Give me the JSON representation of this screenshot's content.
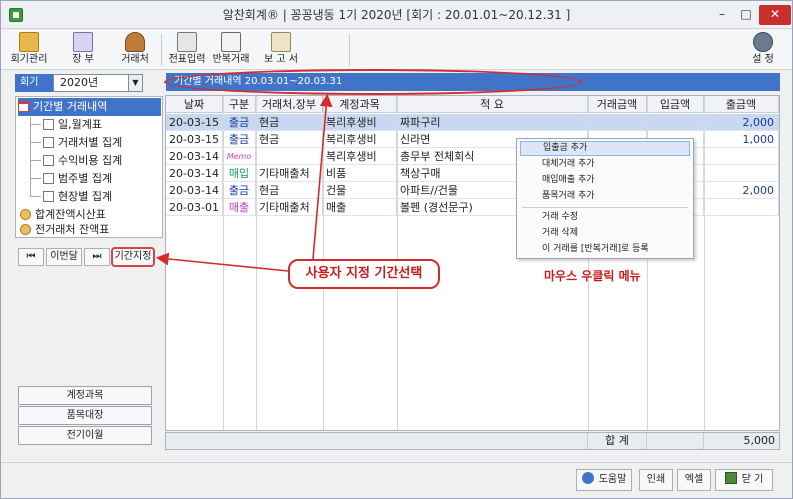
{
  "window": {
    "title": "알찬회계® | 꽁꽁냉동 1기 2020년 [회기 : 20.01.01~20.12.31 ]",
    "controls": {
      "minimize": "–",
      "maximize": "□",
      "close": "✕"
    }
  },
  "toolbar": {
    "accounting": "회기관리",
    "ledger": "장 부",
    "clients": "거래처",
    "voucher": "전표입력",
    "repeat": "반복거래",
    "report": "보 고 서",
    "settings": "설 정"
  },
  "year": {
    "label": "회기",
    "value": "2020년"
  },
  "tree": {
    "root": "기간별 거래내역",
    "children": [
      "일,월계표",
      "거래처별 집계",
      "수익비용 집계",
      "범주별 집계",
      "현장별 집계"
    ],
    "extra": [
      "합계잔액시산표",
      "전거래처 잔액표"
    ]
  },
  "nav": {
    "first": "⏮",
    "month": "이번달",
    "next": "⏭",
    "custom": "기간지정"
  },
  "side_buttons": [
    "계정과목",
    "품목대장",
    "전기이월"
  ],
  "period_bar": {
    "text": "기간별 거래내역   20.03.01~20.03.31"
  },
  "table": {
    "headers": [
      "날짜",
      "구분",
      "거래처,장부",
      "계정과목",
      "적 요",
      "거래금액",
      "입금액",
      "출금액"
    ],
    "rows": [
      {
        "date": "20-03-15",
        "type": "출금",
        "type_color": "#1c3a9a",
        "account": "현금",
        "item": "복리후생비",
        "memo": "짜파구리",
        "amount": "",
        "deposit": "",
        "withdraw": "2,000",
        "selected": true
      },
      {
        "date": "20-03-15",
        "type": "출금",
        "type_color": "#1c3a9a",
        "account": "현금",
        "item": "복리후생비",
        "memo": "신라면",
        "amount": "",
        "deposit": "",
        "withdraw": "1,000",
        "selected": false
      },
      {
        "date": "20-03-14",
        "type": "Memo",
        "type_color": "#e040c0",
        "account": "",
        "item": "복리후생비",
        "memo": "총무부 전체회식",
        "amount": "",
        "deposit": "",
        "withdraw": "",
        "selected": false
      },
      {
        "date": "20-03-14",
        "type": "매입",
        "type_color": "#1a9a6a",
        "account": "기타매출처",
        "item": "비품",
        "memo": "책상구매",
        "amount": "",
        "deposit": "",
        "withdraw": "",
        "selected": false
      },
      {
        "date": "20-03-14",
        "type": "출금",
        "type_color": "#1c3a9a",
        "account": "현금",
        "item": "건물",
        "memo": "아파트//건물",
        "amount": "",
        "deposit": "",
        "withdraw": "2,000",
        "selected": false
      },
      {
        "date": "20-03-01",
        "type": "매출",
        "type_color": "#c040c0",
        "account": "기타매출처",
        "item": "매출",
        "memo": "볼펜 (경선문구)",
        "amount": "",
        "deposit": "",
        "withdraw": "",
        "selected": false
      }
    ],
    "total_label": "합 계",
    "total_withdraw": "5,000"
  },
  "context_menu": {
    "items": [
      "입출금 추가",
      "대체거래 추가",
      "매입매출 추가",
      "품목거래 추가",
      "거래 수정",
      "거래 삭제",
      "이 거래를 [반복거래]로 등록"
    ]
  },
  "annotations": {
    "callout": "사용자 지정 기간선택",
    "right_click": "마우스 우클릭 메뉴"
  },
  "statusbar": {
    "help": "도움말",
    "print": "인쇄",
    "excel": "엑셀",
    "close": "닫 기"
  }
}
